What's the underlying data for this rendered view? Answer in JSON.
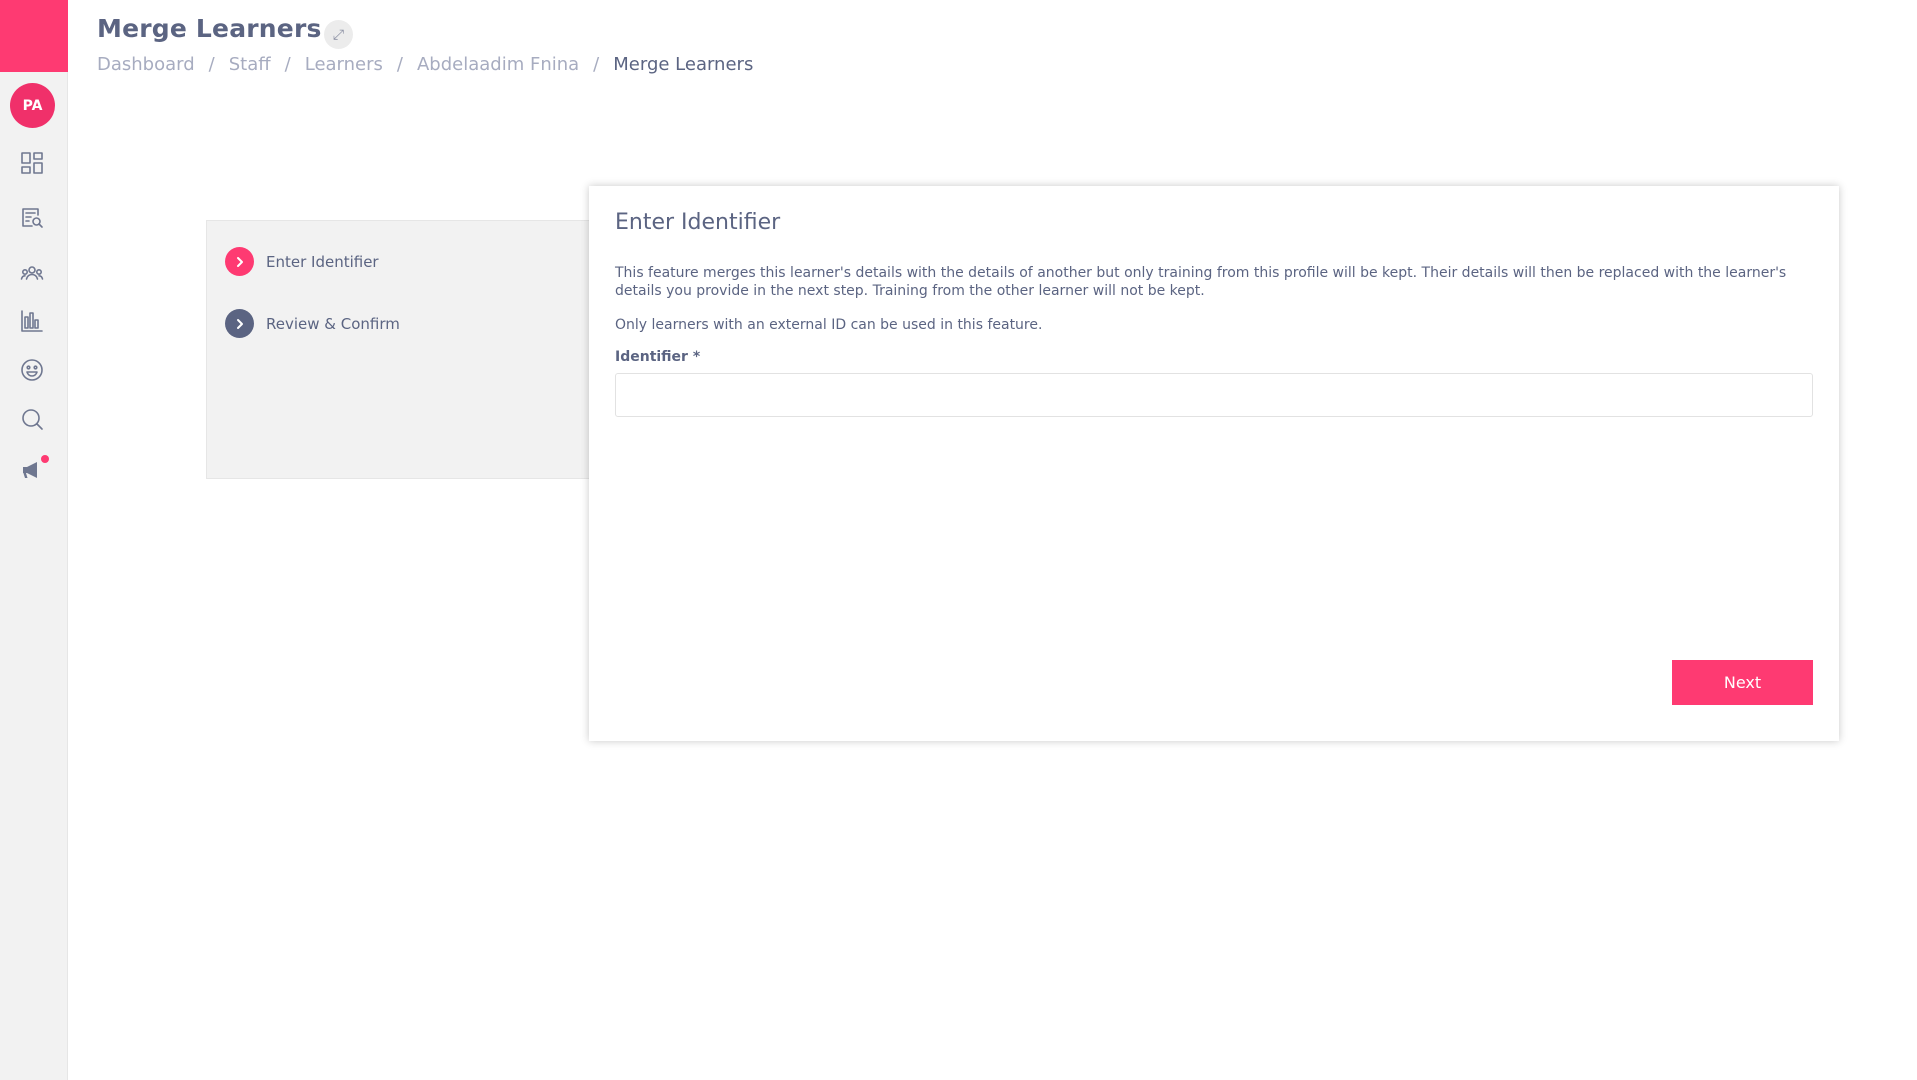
{
  "sidebar": {
    "avatar_initials": "PA",
    "brand_color": "#fe3a72",
    "items": [
      {
        "icon": "dashboard-icon"
      },
      {
        "icon": "document-search-icon"
      },
      {
        "icon": "people-icon"
      },
      {
        "icon": "bar-chart-icon"
      },
      {
        "icon": "smiley-icon"
      },
      {
        "icon": "search-icon"
      },
      {
        "icon": "megaphone-icon",
        "has_notification": true
      }
    ]
  },
  "header": {
    "title": "Merge Learners",
    "expand_icon": "⤢",
    "breadcrumb": [
      {
        "label": "Dashboard"
      },
      {
        "label": "Staff"
      },
      {
        "label": "Learners"
      },
      {
        "label": "Abdelaadim Fnina"
      },
      {
        "label": "Merge Learners"
      }
    ],
    "separator": "/"
  },
  "steps": [
    {
      "label": "Enter Identifier",
      "active": true,
      "color": "#fe3a72"
    },
    {
      "label": "Review & Confirm",
      "active": false,
      "color": "#5b6482"
    }
  ],
  "card": {
    "title": "Enter Identifier",
    "description": "This feature merges this learner's details with the details of another but only training from this profile will be kept. Their details will then be replaced with the learner's details you provide in the next step. Training from the other learner will not be kept.",
    "note": "Only learners with an external ID can be used in this feature.",
    "field_label": "Identifier *",
    "field_value": "",
    "next_label": "Next"
  }
}
